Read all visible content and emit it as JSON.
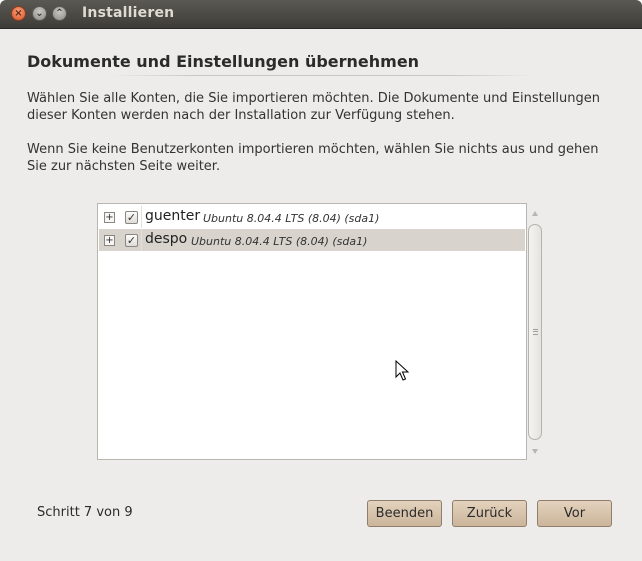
{
  "window": {
    "title": "Installieren",
    "buttons": {
      "close": "×",
      "minimize": "⌄",
      "maximize": "⌃"
    }
  },
  "page": {
    "heading": "Dokumente und Einstellungen übernehmen",
    "paragraph1": "Wählen Sie alle Konten, die Sie importieren möchten. Die Dokumente und Einstellungen dieser Konten werden nach der Installation zur Verfügung stehen.",
    "paragraph2": "Wenn Sie keine Benutzerkonten importieren möchten, wählen Sie nichts aus und gehen Sie zur nächsten Seite weiter."
  },
  "accounts": [
    {
      "user": "guenter",
      "os": "Ubuntu 8.04.4 LTS (8.04) (sda1)",
      "checked": true,
      "selected": false
    },
    {
      "user": "despo",
      "os": "Ubuntu 8.04.4 LTS (8.04) (sda1)",
      "checked": true,
      "selected": true
    }
  ],
  "symbols": {
    "expander": "+",
    "checkmark": "✓"
  },
  "footer": {
    "step": "Schritt 7 von 9",
    "quit_label": "Beenden",
    "back_label": "Zurück",
    "forward_label": "Vor"
  },
  "colors": {
    "titlebar": "#3d3c38",
    "button": "#cbb59b",
    "selected_row": "#d8d4cd"
  }
}
